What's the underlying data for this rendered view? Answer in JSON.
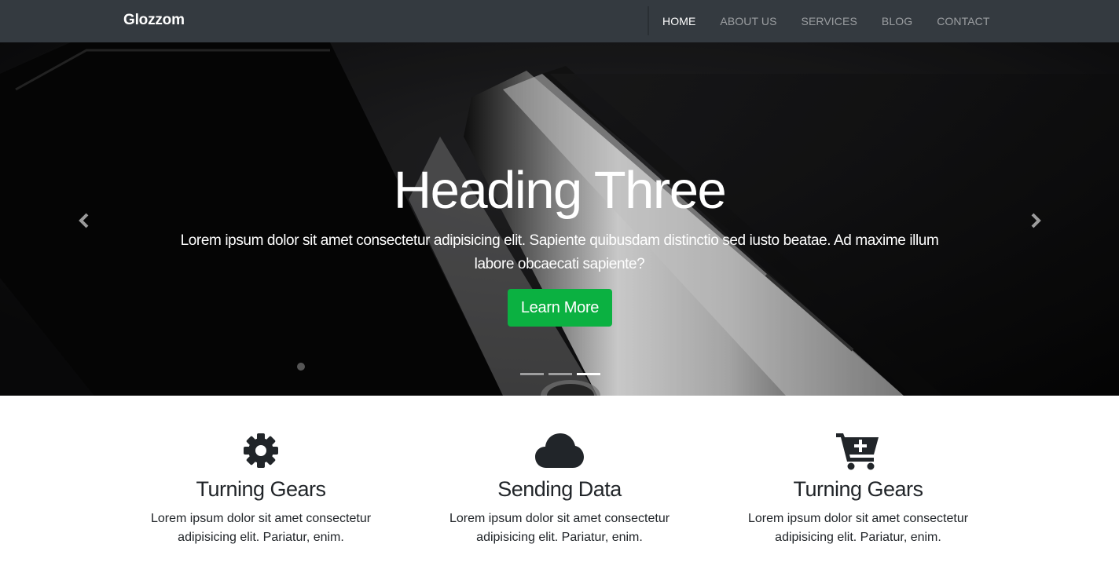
{
  "navbar": {
    "brand": "Glozzom",
    "links": [
      {
        "label": "HOME",
        "active": true
      },
      {
        "label": "ABOUT US",
        "active": false
      },
      {
        "label": "SERVICES",
        "active": false
      },
      {
        "label": "BLOG",
        "active": false
      },
      {
        "label": "CONTACT",
        "active": false
      }
    ]
  },
  "hero": {
    "title": "Heading Three",
    "text": "Lorem ipsum dolor sit amet consectetur adipisicing elit. Sapiente quibusdam distinctio sed iusto beatae. Ad maxime illum labore obcaecati sapiente?",
    "button_label": "Learn More",
    "indicators": 3,
    "active_indicator": 3
  },
  "features": [
    {
      "icon": "gear-icon",
      "title": "Turning Gears",
      "text": "Lorem ipsum dolor sit amet consectetur adipisicing elit. Pariatur, enim."
    },
    {
      "icon": "cloud-icon",
      "title": "Sending Data",
      "text": "Lorem ipsum dolor sit amet consectetur adipisicing elit. Pariatur, enim."
    },
    {
      "icon": "cart-plus-icon",
      "title": "Turning Gears",
      "text": "Lorem ipsum dolor sit amet consectetur adipisicing elit. Pariatur, enim."
    }
  ],
  "colors": {
    "navbar_bg": "#343a40",
    "button_green": "#0bb141",
    "icon_dark": "#212529"
  }
}
